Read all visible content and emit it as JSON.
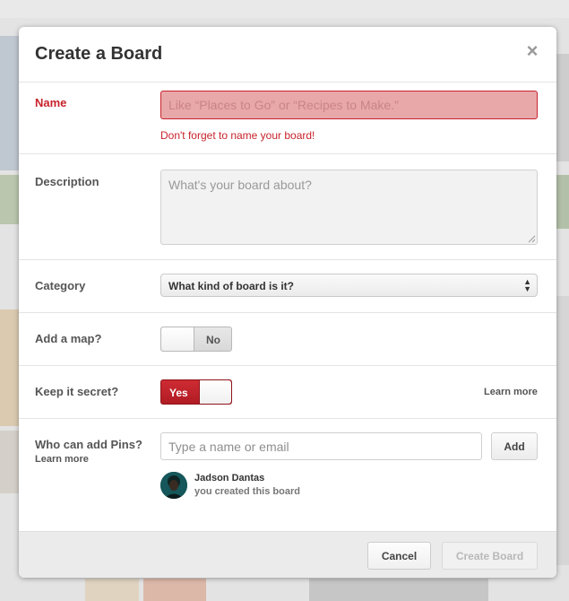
{
  "modal": {
    "title": "Create a Board",
    "close_label": "×"
  },
  "name": {
    "label": "Name",
    "placeholder": "Like “Places to Go” or “Recipes to Make.”",
    "value": "",
    "error": "Don't forget to name your board!"
  },
  "description": {
    "label": "Description",
    "placeholder": "What's your board about?",
    "value": ""
  },
  "category": {
    "label": "Category",
    "selected": "What kind of board is it?",
    "arrows": "▲▼"
  },
  "map": {
    "label": "Add a map?",
    "toggle_text": "No",
    "enabled": false
  },
  "secret": {
    "label": "Keep it secret?",
    "toggle_text": "Yes",
    "enabled": true,
    "learn_more": "Learn more"
  },
  "collaborators": {
    "label": "Who can add Pins?",
    "learn_more": "Learn more",
    "placeholder": "Type a name or email",
    "add_label": "Add",
    "owner_name": "Jadson Dantas",
    "owner_note": "you created this board"
  },
  "footer": {
    "cancel_label": "Cancel",
    "create_label": "Create Board"
  },
  "colors": {
    "accent_red": "#c8232c",
    "error_field": "#e8a7a9",
    "footer_bg": "#ebebeb"
  },
  "icons": {
    "close": "close-icon",
    "select_arrows": "select-arrows-icon",
    "resize": "resize-grip-icon"
  }
}
